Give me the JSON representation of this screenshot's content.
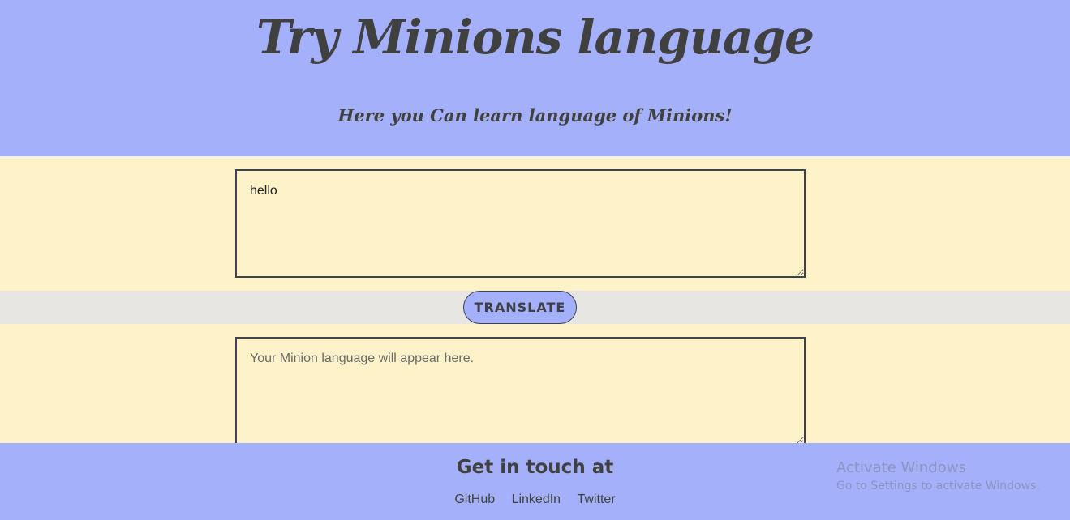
{
  "header": {
    "title": "Try Minions language",
    "subtitle": "Here you Can learn language of Minions!"
  },
  "input": {
    "value": "hello"
  },
  "translate_button": {
    "label": "TRANSLATE"
  },
  "output": {
    "placeholder": "Your Minion language will appear here.",
    "value": ""
  },
  "footer": {
    "heading": "Get in touch at",
    "links": [
      "GitHub",
      "LinkedIn",
      "Twitter"
    ]
  },
  "watermark": {
    "title": "Activate Windows",
    "subtitle": "Go to Settings to activate Windows."
  },
  "colors": {
    "header_bg": "#a4b0f9",
    "body_bg": "#fdf2c8",
    "button_band_bg": "#e8e6e2",
    "text_dark": "#404040"
  }
}
